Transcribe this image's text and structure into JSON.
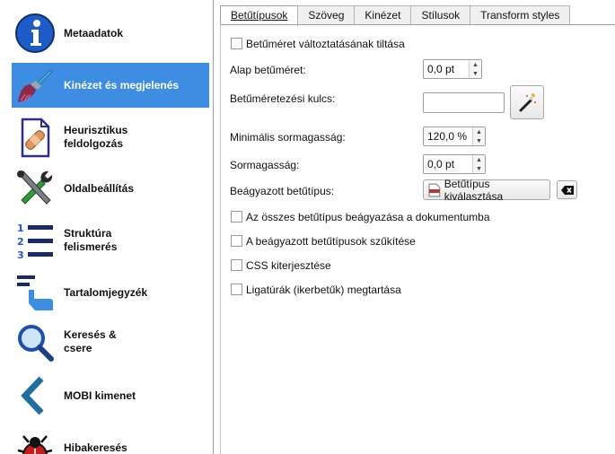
{
  "sidebar": {
    "items": [
      {
        "label": "Metaadatok",
        "icon": "info-icon"
      },
      {
        "label": "Kinézet és megjelenés",
        "icon": "brush-icon"
      },
      {
        "label": "Heurisztikus feldolgozás",
        "icon": "document-bandage-icon"
      },
      {
        "label": "Oldalbeállítás",
        "icon": "tools-icon"
      },
      {
        "label": "Struktúra felismerés",
        "icon": "numbered-list-icon"
      },
      {
        "label": "Tartalomjegyzék",
        "icon": "toc-pointer-icon"
      },
      {
        "label": "Keresés & csere",
        "icon": "magnifier-icon"
      },
      {
        "label": "MOBI kimenet",
        "icon": "mobi-chevron-icon"
      },
      {
        "label": "Hibakeresés",
        "icon": "bug-icon"
      }
    ],
    "active_index": 1
  },
  "tabs": [
    {
      "label": "Betűtípusok",
      "active": true
    },
    {
      "label": "Szöveg",
      "active": false
    },
    {
      "label": "Kinézet",
      "active": false
    },
    {
      "label": "Stílusok",
      "active": false
    },
    {
      "label": "Transform styles",
      "active": false
    }
  ],
  "form": {
    "disable_font_rescaling": {
      "label": "Betűméret változtatásának tiltása",
      "checked": false
    },
    "base_font_size": {
      "label": "Alap betűméret:",
      "value": "0,0 pt"
    },
    "font_size_key": {
      "label": "Betűméretezési kulcs:",
      "value": "",
      "wizard_icon": "magic-wand-icon"
    },
    "min_line_height": {
      "label": "Minimális sormagasság:",
      "value": "120,0 %"
    },
    "line_height": {
      "label": "Sormagasság:",
      "value": "0,0 pt"
    },
    "embedded_font": {
      "label": "Beágyazott betűtípus:",
      "button": "Betűtípus kiválasztása",
      "button_icon": "ttf-file-icon",
      "clear_icon": "clear-backspace-icon"
    },
    "embed_all_fonts": {
      "label": "Az összes betűtípus beágyazása a dokumentumba",
      "checked": false
    },
    "subset_embedded_fonts": {
      "label": "A beágyazott betűtípusok szűkítése",
      "checked": false
    },
    "expand_css": {
      "label": "CSS kiterjesztése",
      "checked": false
    },
    "keep_ligatures": {
      "label": "Ligatúrák (ikerbetűk) megtartása",
      "checked": false
    }
  },
  "colors": {
    "active_item": "#3d8ee3",
    "info_icon": "#1d5cc7"
  }
}
